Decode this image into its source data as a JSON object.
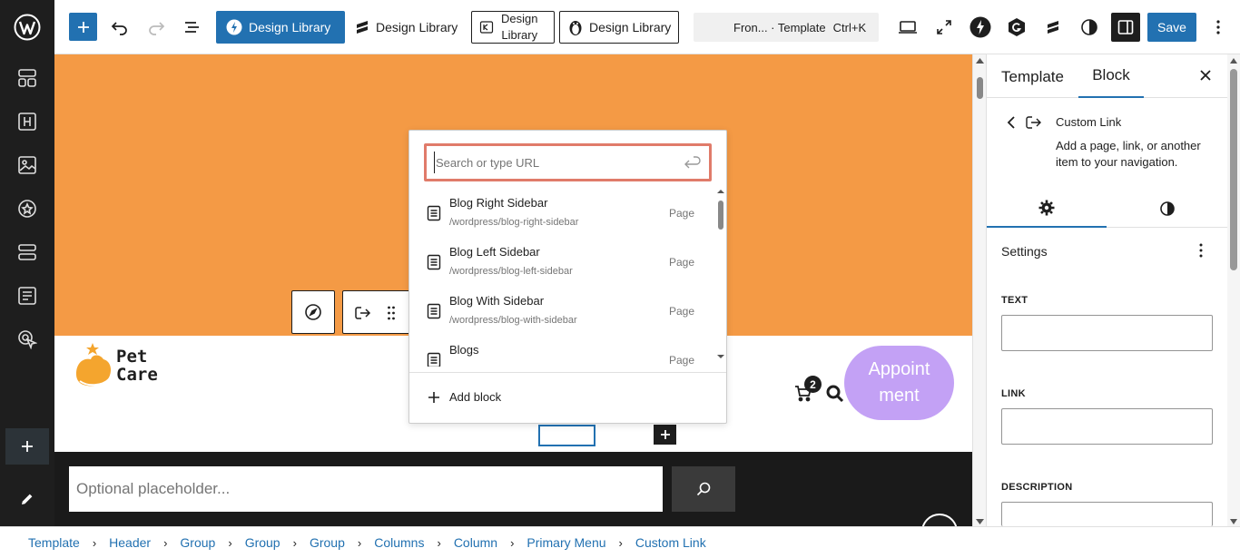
{
  "toolbar": {
    "design_library_1": "Design Library",
    "design_library_2": "Design Library",
    "design_library_3_line1": "Design",
    "design_library_3_line2": "Library",
    "design_library_4": "Design Library",
    "command_title": "Fron... · Template",
    "command_shortcut": "Ctrl+K",
    "save_label": "Save"
  },
  "link_popover": {
    "search_placeholder": "Search or type URL",
    "suggestions": [
      {
        "title": "Blog Right Sidebar",
        "url": "/wordpress/blog-right-sidebar",
        "type": "Page"
      },
      {
        "title": "Blog Left Sidebar",
        "url": "/wordpress/blog-left-sidebar",
        "type": "Page"
      },
      {
        "title": "Blog With Sidebar",
        "url": "/wordpress/blog-with-sidebar",
        "type": "Page"
      },
      {
        "title": "Blogs",
        "url": "",
        "type": "Page"
      }
    ],
    "add_block_label": "Add block"
  },
  "site_header": {
    "logo_line1": "Pet",
    "logo_line2": "Care",
    "cart_count": "2",
    "appointment_line1": "Appoint",
    "appointment_line2": "ment",
    "search_placeholder": "Optional placeholder..."
  },
  "sidebar": {
    "tabs": [
      "Template",
      "Block"
    ],
    "active_tab": "Block",
    "block_title": "Custom Link",
    "block_description": "Add a page, link, or another item to your navigation.",
    "settings_label": "Settings",
    "fields": [
      "TEXT",
      "LINK",
      "DESCRIPTION"
    ]
  },
  "breadcrumb": [
    "Template",
    "Header",
    "Group",
    "Group",
    "Group",
    "Columns",
    "Column",
    "Primary Menu",
    "Custom Link"
  ],
  "colors": {
    "accent": "#2271b1",
    "canvas_orange": "#f49a45",
    "appointment_purple": "#c3a1f5",
    "dark_bar": "#1a1a1a",
    "input_highlight": "#e07b6a"
  }
}
